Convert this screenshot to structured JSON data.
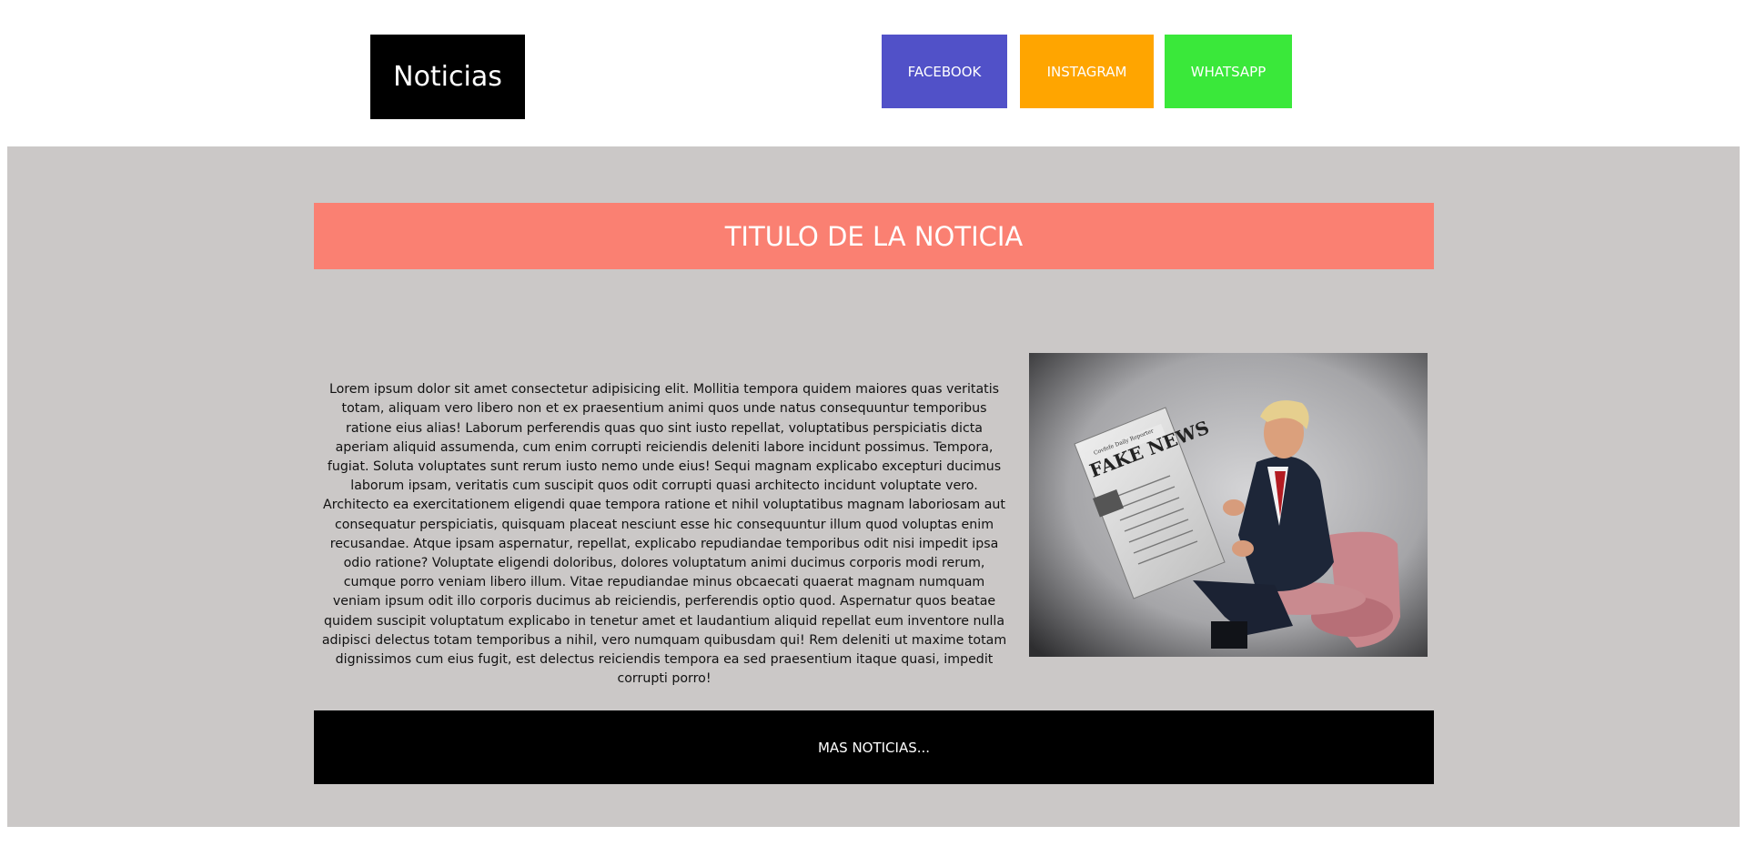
{
  "header": {
    "logo_text": "Noticias",
    "social": [
      {
        "label": "FACEBOOK",
        "color": "#5151c8"
      },
      {
        "label": "INSTAGRAM",
        "color": "#ffa500"
      },
      {
        "label": "WHATSAPP",
        "color": "#3ae83a"
      }
    ]
  },
  "main": {
    "background": "#cbc8c7",
    "title": "TITULO DE LA NOTICIA",
    "title_background": "#fa8072",
    "body": "Lorem ipsum dolor sit amet consectetur adipisicing elit. Mollitia tempora quidem maiores quas veritatis totam, aliquam vero libero non et ex praesentium animi quos unde natus consequuntur temporibus ratione eius alias! Laborum perferendis quas quo sint iusto repellat, voluptatibus perspiciatis dicta aperiam aliquid assumenda, cum enim corrupti reiciendis deleniti labore incidunt possimus. Tempora, fugiat. Soluta voluptates sunt rerum iusto nemo unde eius! Sequi magnam explicabo excepturi ducimus laborum ipsam, veritatis cum suscipit quos odit corrupti quasi architecto incidunt voluptate vero. Architecto ea exercitationem eligendi quae tempora ratione et nihil voluptatibus magnam laboriosam aut consequatur perspiciatis, quisquam placeat nesciunt esse hic consequuntur illum quod voluptas enim recusandae. Atque ipsam aspernatur, repellat, explicabo repudiandae temporibus odit nisi impedit ipsa odio ratione? Voluptate eligendi doloribus, dolores voluptatum animi ducimus corporis modi rerum, cumque porro veniam libero illum. Vitae repudiandae minus obcaecati quaerat magnam numquam veniam ipsum odit illo corporis ducimus ab reiciendis, perferendis optio quod. Aspernatur quos beatae quidem suscipit voluptatum explicabo in tenetur amet et laudantium aliquid repellat eum inventore nulla adipisci delectus totam temporibus a nihil, vero numquam quibusdam qui! Rem deleniti ut maxime totam dignissimos cum eius fugit, est delectus reiciendis tempora ea sed praesentium itaque quasi, impedit corrupti porro!",
    "image": {
      "newspaper_headline": "FAKE NEWS",
      "newspaper_masthead": "Covfefe Daily Reporter"
    },
    "more_label": "MAS NOTICIAS..."
  }
}
